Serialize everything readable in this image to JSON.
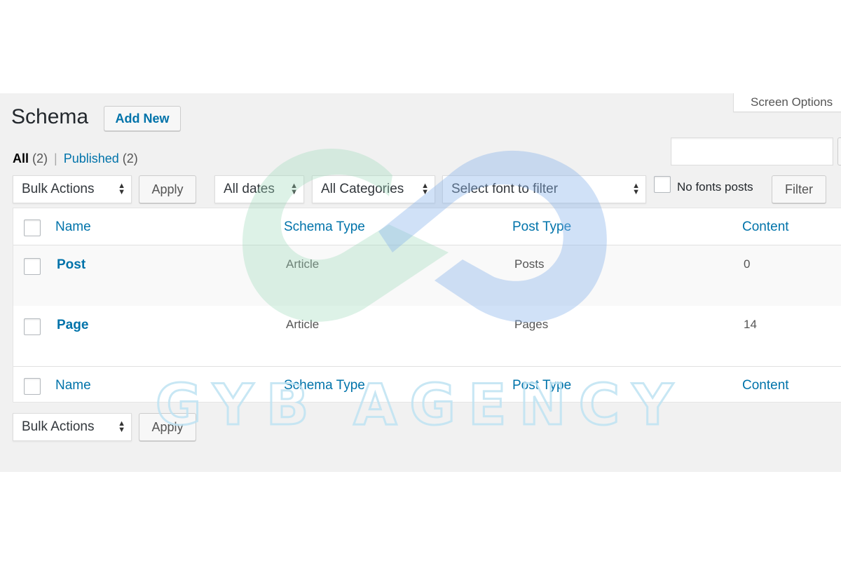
{
  "screen_options": "Screen Options",
  "page_title": "Schema",
  "add_new": "Add New",
  "views": {
    "all_label": "All",
    "all_count": "(2)",
    "separator": "|",
    "published_label": "Published",
    "published_count": "(2)"
  },
  "bulk_actions_top": {
    "label": "Bulk Actions",
    "apply": "Apply"
  },
  "filters": {
    "dates": "All dates",
    "categories": "All Categories",
    "font": "Select font to filter",
    "no_fonts_label": "No fonts posts",
    "filter_button": "Filter"
  },
  "columns": [
    "Name",
    "Schema Type",
    "Post Type",
    "Content"
  ],
  "rows": [
    {
      "name": "Post",
      "schema_type": "Article",
      "post_type": "Posts",
      "content": "0"
    },
    {
      "name": "Page",
      "schema_type": "Article",
      "post_type": "Pages",
      "content": "14"
    }
  ],
  "bulk_actions_bottom": {
    "label": "Bulk Actions",
    "apply": "Apply"
  },
  "watermark_text": "GYB AGENCY",
  "colors": {
    "link": "#0073aa",
    "background": "#f1f1f1",
    "wm_green": "#c9ead8",
    "wm_blue": "#b9d3f2"
  }
}
